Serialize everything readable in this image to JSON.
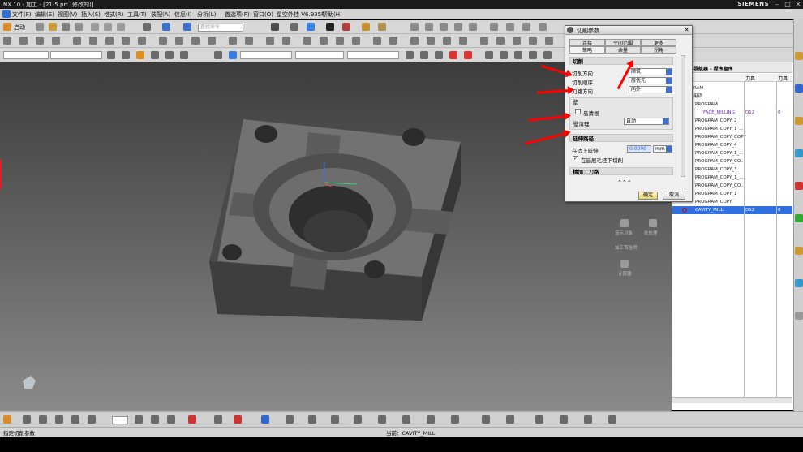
{
  "window": {
    "title": "NX 10 - 加工 - [21-5.prt (修改的)]",
    "brand": "SIEMENS"
  },
  "menubar": [
    "文件(F)",
    "编辑(E)",
    "视图(V)",
    "插入(S)",
    "格式(R)",
    "工具(T)",
    "装配(A)",
    "信息(I)",
    "分析(L)",
    "首选项(P)",
    "窗口(O)",
    "星空外挂 V6.935P",
    "帮助(H)"
  ],
  "toolbar": {
    "start_label": "启动",
    "search_placeholder": "查找命令"
  },
  "dialog": {
    "title": "切削参数",
    "tabs_row1": [
      "连接",
      "空间范围",
      "更多"
    ],
    "tabs_row2": [
      "策略",
      "余量",
      "拐角"
    ],
    "sections": {
      "cutting": "切削",
      "wall": "壁",
      "extend": "延伸路径",
      "refine": "精加工刀路"
    },
    "fields": {
      "cut_direction": {
        "label": "切削方向",
        "value": "顺铣"
      },
      "cut_order": {
        "label": "切削顺序",
        "value": "层优先"
      },
      "pattern_direction": {
        "label": "刀路方向",
        "value": "向外"
      },
      "island_cleanup": {
        "label": "岛清根",
        "checked": false
      },
      "wall_cleanup": {
        "label": "壁清理",
        "value": "自动"
      },
      "extend_on_edge": {
        "label": "在边上延伸",
        "value": "0.0000",
        "unit": "mm"
      },
      "cut_below_blank_edge": {
        "label": "在延展毛坯下切削",
        "checked": true
      }
    },
    "ok": "确定",
    "cancel": "取消"
  },
  "navigator": {
    "title": "序导航器 - 程序顺序",
    "columns": [
      "",
      "刀具",
      "刀具"
    ],
    "rows": [
      {
        "name": "RAM",
        "tool": "",
        "num": ""
      },
      {
        "name": "用项",
        "tool": "",
        "num": ""
      },
      {
        "name": "PROGRAM",
        "tool": "",
        "num": ""
      },
      {
        "name": "FACE_MILLING",
        "tool": "D12",
        "num": "0"
      },
      {
        "name": "PROGRAM_COPY_2",
        "tool": "",
        "num": ""
      },
      {
        "name": "PROGRAM_COPY_1_...",
        "tool": "",
        "num": ""
      },
      {
        "name": "PROGRAM_COPY_COPY",
        "tool": "",
        "num": ""
      },
      {
        "name": "PROGRAM_COPY_4",
        "tool": "",
        "num": ""
      },
      {
        "name": "PROGRAM_COPY_1_...",
        "tool": "",
        "num": ""
      },
      {
        "name": "PROGRAM_COPY_CO...",
        "tool": "",
        "num": ""
      },
      {
        "name": "PROGRAM_COPY_3",
        "tool": "",
        "num": ""
      },
      {
        "name": "PROGRAM_COPY_1_...",
        "tool": "",
        "num": ""
      },
      {
        "name": "PROGRAM_COPY_CO...",
        "tool": "",
        "num": ""
      },
      {
        "name": "PROGRAM_COPY_1",
        "tool": "",
        "num": ""
      },
      {
        "name": "PROGRAM_COPY",
        "tool": "",
        "num": ""
      },
      {
        "name": "CAVITY_MILL",
        "tool": "D12",
        "num": "0"
      }
    ]
  },
  "side_panel": {
    "items": [
      "显示对象",
      "批处理",
      "加工首选项",
      "计算器"
    ]
  },
  "statusbar": {
    "left": "指定切削参数",
    "center": "当前：CAVITY_MILL"
  },
  "colors": {
    "accent": "#3f6fcf",
    "arrow": "#ff0000",
    "selection": "#2f6fe0"
  }
}
